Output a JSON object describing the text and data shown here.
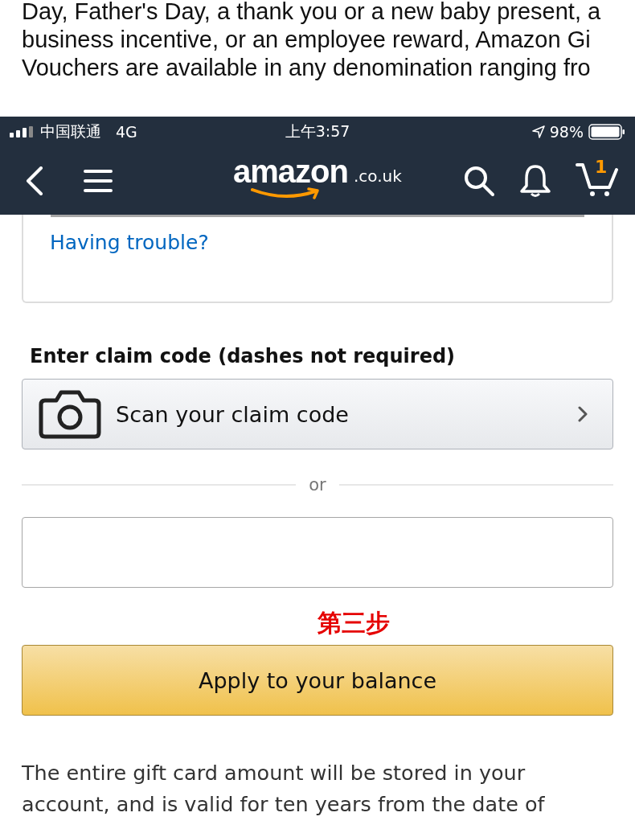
{
  "article": {
    "lines": [
      "Day, Father's Day, a thank you or a new baby present, a",
      "business incentive, or an employee reward, Amazon Gi",
      "Vouchers are available in any denomination ranging fro"
    ]
  },
  "status_bar": {
    "carrier": "中国联通",
    "network": "4G",
    "time": "上午3:57",
    "battery": "98%"
  },
  "nav": {
    "logo": "amazon",
    "logo_suffix": ".co.uk",
    "cart_count": "1"
  },
  "card": {
    "link": "Having trouble?"
  },
  "claim": {
    "heading": "Enter claim code (dashes not required)",
    "scan_button": "Scan your claim code",
    "divider": "or"
  },
  "annotation": "第三步",
  "apply_button": "Apply to your balance",
  "note_lines": [
    "The entire gift card amount will be stored in your",
    "account, and is valid for ten years from the date of"
  ]
}
